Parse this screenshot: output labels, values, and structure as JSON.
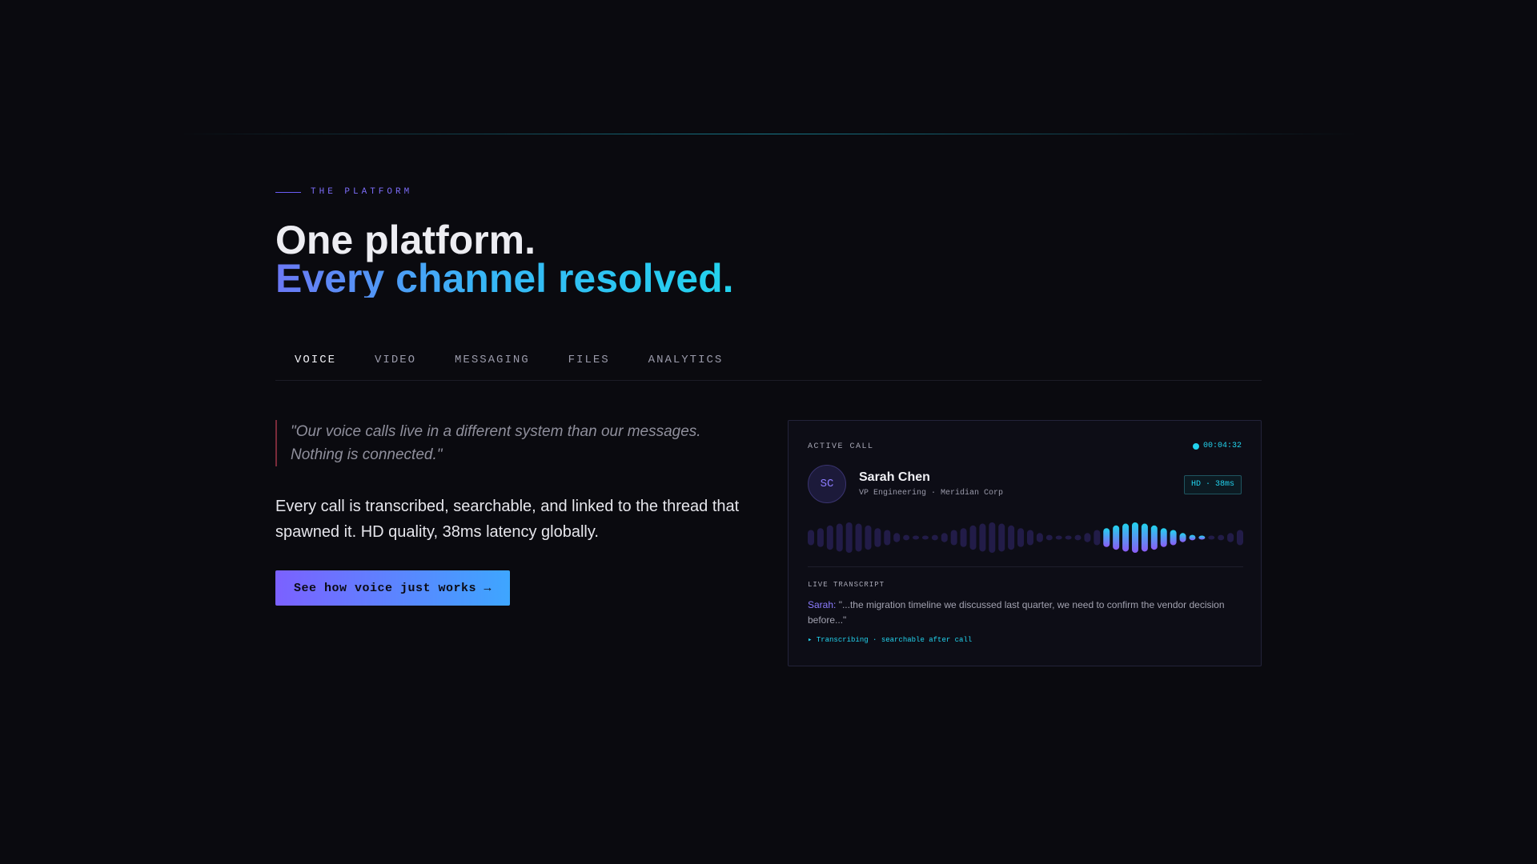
{
  "eyebrow": "THE PLATFORM",
  "headline": {
    "line1": "One platform.",
    "line2": "Every channel resolved."
  },
  "tabs": [
    {
      "label": "VOICE",
      "active": true
    },
    {
      "label": "VIDEO",
      "active": false
    },
    {
      "label": "MESSAGING",
      "active": false
    },
    {
      "label": "FILES",
      "active": false
    },
    {
      "label": "ANALYTICS",
      "active": false
    }
  ],
  "quote": "\"Our voice calls live in a different system than our messages. Nothing is connected.\"",
  "body": "Every call is transcribed, searchable, and linked to the thread that spawned it. HD quality, 38ms latency globally.",
  "cta": "See how voice just works →",
  "call_card": {
    "label": "ACTIVE CALL",
    "timer": "00:04:32",
    "avatar_initials": "SC",
    "caller_name": "Sarah Chen",
    "caller_role": "VP Engineering · Meridian Corp",
    "quality_badge": "HD · 38ms",
    "transcript_label": "LIVE TRANSCRIPT",
    "transcript_speaker": "Sarah:",
    "transcript_text": " \"...the migration timeline we discussed last quarter, we need to confirm the vendor decision before...\"",
    "transcribing_status": "▸ Transcribing · searchable after call"
  },
  "waveform": {
    "levels": [
      0.5,
      0.62,
      0.8,
      0.92,
      1.0,
      0.92,
      0.8,
      0.62,
      0.5,
      0.3,
      0.18,
      0.12,
      0.12,
      0.18,
      0.3,
      0.5,
      0.62,
      0.8,
      0.92,
      1.0,
      0.92,
      0.8,
      0.62,
      0.5,
      0.3,
      0.18,
      0.12,
      0.12,
      0.18,
      0.3,
      0.5,
      0.62,
      0.8,
      0.92,
      1.0,
      0.92,
      0.8,
      0.62,
      0.5,
      0.3,
      0.18,
      0.12,
      0.12,
      0.18,
      0.3,
      0.5
    ],
    "active_from": 31,
    "active_to": 41,
    "colors": {
      "idle": "#221c48",
      "active_start": "#22d3ee",
      "active_end": "#8b5cf6"
    }
  }
}
